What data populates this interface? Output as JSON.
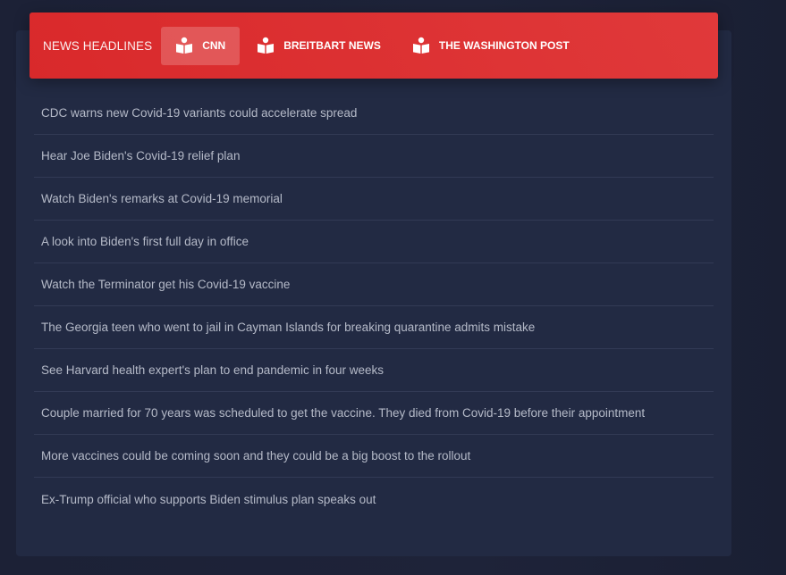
{
  "header": {
    "title": "NEWS HEADLINES",
    "tabs": [
      {
        "label": "CNN",
        "icon": "reader-icon",
        "active": true
      },
      {
        "label": "BREITBART NEWS",
        "icon": "reader-icon",
        "active": false
      },
      {
        "label": "THE WASHINGTON POST",
        "icon": "reader-icon",
        "active": false
      }
    ]
  },
  "headlines": [
    "CDC warns new Covid-19 variants could accelerate spread",
    "Hear Joe Biden's Covid-19 relief plan",
    "Watch Biden's remarks at Covid-19 memorial",
    "A look into Biden's first full day in office",
    "Watch the Terminator get his Covid-19 vaccine",
    "The Georgia teen who went to jail in Cayman Islands for breaking quarantine admits mistake",
    "See Harvard health expert's plan to end pandemic in four weeks",
    "Couple married for 70 years was scheduled to get the vaccine. They died from Covid-19 before their appointment",
    "More vaccines could be coming soon and they could be a big boost to the rollout",
    "Ex-Trump official who supports Biden stimulus plan speaks out"
  ],
  "colors": {
    "header": "#dc3030",
    "card": "#222a43",
    "background": "#1c2136",
    "text": "#b5bac8"
  }
}
